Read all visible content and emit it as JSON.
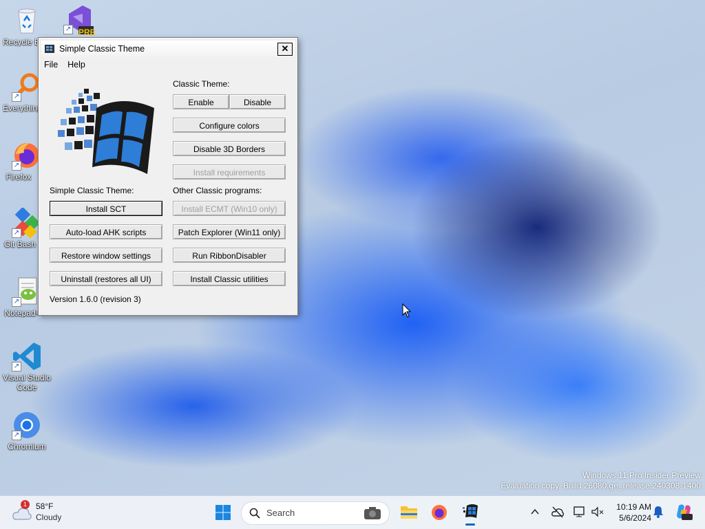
{
  "desktop": {
    "icons": [
      {
        "label": "Recycle Bin"
      },
      {
        "label": "PRE"
      },
      {
        "label": "Everything"
      },
      {
        "label": "Firefox"
      },
      {
        "label": "Git Bash"
      },
      {
        "label": "Notepad++"
      },
      {
        "label": "Visual Studio Code"
      },
      {
        "label": "Chromium"
      }
    ],
    "watermark_line1": "Windows 11 Pro Insider Preview",
    "watermark_line2": "Evaluation copy. Build 26080.ge_release.240308-1400"
  },
  "window": {
    "title": "Simple Classic Theme",
    "close_glyph": "✕",
    "menu": [
      "File",
      "Help"
    ],
    "classic_theme_label": "Classic Theme:",
    "enable_label": "Enable",
    "disable_label": "Disable",
    "configure_colors_label": "Configure colors",
    "disable_3d_borders_label": "Disable 3D Borders",
    "install_requirements_label": "Install requirements",
    "sct_label": "Simple Classic Theme:",
    "other_programs_label": "Other Classic programs:",
    "install_sct_label": "Install SCT",
    "install_ecmt_label": "Install ECMT (Win10 only)",
    "autoload_ahk_label": "Auto-load AHK scripts",
    "patch_explorer_label": "Patch Explorer (Win11 only)",
    "restore_window_label": "Restore window settings",
    "run_ribbon_label": "Run RibbonDisabler",
    "uninstall_label": "Uninstall (restores all UI)",
    "install_utilities_label": "Install Classic utilities",
    "version_label": "Version 1.6.0 (revision 3)"
  },
  "taskbar": {
    "weather_temp": "58°F",
    "weather_desc": "Cloudy",
    "weather_badge": "1",
    "search_placeholder": "Search",
    "time": "10:19 AM",
    "date": "5/6/2024",
    "tray_chevron": "^"
  },
  "colors": {
    "accent": "#0067c0",
    "window_bg": "#f0f0f0"
  }
}
